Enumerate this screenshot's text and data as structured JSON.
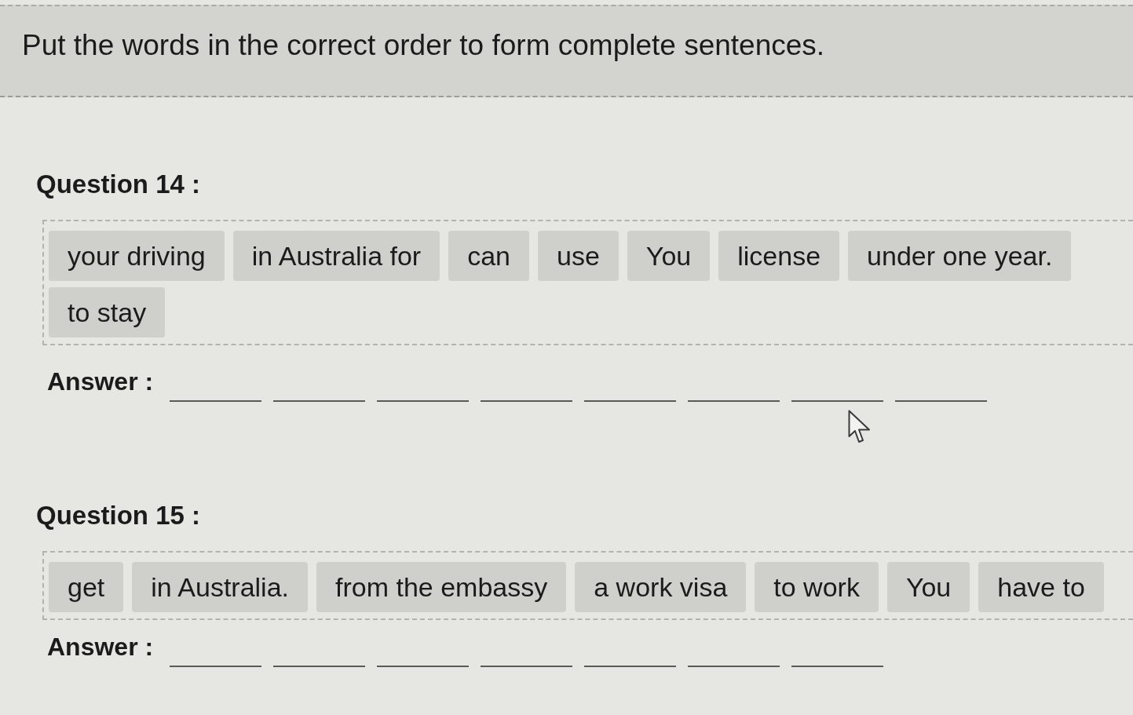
{
  "instructions": "Put the words in the correct order to form complete sentences.",
  "questions": [
    {
      "title": "Question 14 :",
      "words": [
        "your driving",
        "in Australia for",
        "can",
        "use",
        "You",
        "license",
        "under one year.",
        "to stay"
      ],
      "answer_label": "Answer :"
    },
    {
      "title": "Question 15 :",
      "words": [
        "get",
        "in Australia.",
        "from the embassy",
        "a work visa",
        "to work",
        "You",
        "have to"
      ],
      "answer_label": "Answer :"
    }
  ]
}
